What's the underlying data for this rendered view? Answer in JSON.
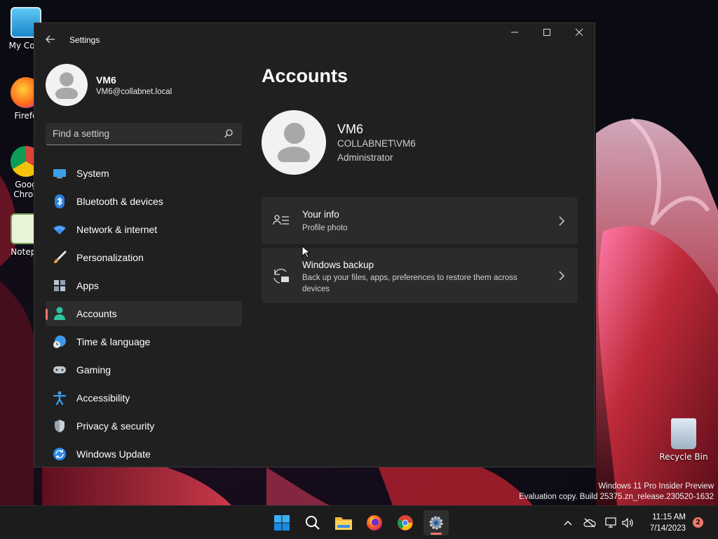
{
  "desktop": {
    "icons": [
      {
        "label": "My Com",
        "icon": "computer-icon"
      },
      {
        "label": "Firefo",
        "icon": "firefox-icon"
      },
      {
        "label": "Goog Chron",
        "icon": "chrome-icon"
      },
      {
        "label": "Notepa",
        "icon": "notepad-icon"
      },
      {
        "label": "Recycle Bin",
        "icon": "recycle-bin-icon"
      }
    ],
    "watermark_line1": "Windows 11 Pro Insider Preview",
    "watermark_line2": "Evaluation copy. Build 25375.zn_release.230520-1632"
  },
  "window": {
    "title": "Settings",
    "controls": {
      "minimize": "—",
      "maximize": "☐",
      "close": "✕"
    }
  },
  "profile": {
    "name": "VM6",
    "email": "VM6@collabnet.local"
  },
  "search": {
    "placeholder": "Find a setting"
  },
  "nav": {
    "items": [
      {
        "label": "System",
        "icon": "system-icon"
      },
      {
        "label": "Bluetooth & devices",
        "icon": "bluetooth-icon"
      },
      {
        "label": "Network & internet",
        "icon": "wifi-icon"
      },
      {
        "label": "Personalization",
        "icon": "brush-icon"
      },
      {
        "label": "Apps",
        "icon": "apps-icon"
      },
      {
        "label": "Accounts",
        "icon": "accounts-icon",
        "active": true
      },
      {
        "label": "Time & language",
        "icon": "globe-clock-icon"
      },
      {
        "label": "Gaming",
        "icon": "gamepad-icon"
      },
      {
        "label": "Accessibility",
        "icon": "accessibility-icon"
      },
      {
        "label": "Privacy & security",
        "icon": "shield-icon"
      },
      {
        "label": "Windows Update",
        "icon": "update-icon"
      }
    ]
  },
  "main": {
    "title": "Accounts",
    "account": {
      "name": "VM6",
      "domain": "COLLABNET\\VM6",
      "role": "Administrator"
    },
    "cards": [
      {
        "title": "Your info",
        "subtitle": "Profile photo",
        "icon": "user-info-icon"
      },
      {
        "title": "Windows backup",
        "subtitle": "Back up your files, apps, preferences to restore them across devices",
        "icon": "backup-icon"
      }
    ]
  },
  "taskbar": {
    "apps": [
      "windows-start-icon",
      "search-icon",
      "file-explorer-icon",
      "firefox-icon",
      "chrome-icon",
      "settings-icon"
    ],
    "time": "11:15 AM",
    "date": "7/14/2023",
    "notifications": "2"
  },
  "colors": {
    "accent": "#f0786d",
    "window_bg": "#202020",
    "card_bg": "#2b2b2b"
  }
}
